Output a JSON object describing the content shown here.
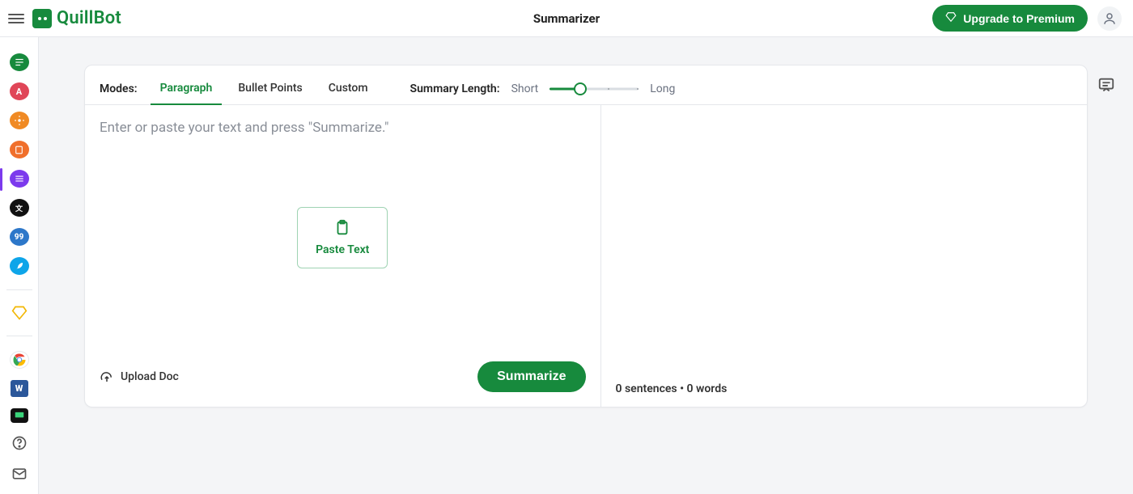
{
  "header": {
    "brand": "QuillBot",
    "title": "Summarizer",
    "upgrade_label": "Upgrade to Premium"
  },
  "sidebar": {
    "items": [
      {
        "name": "paraphraser",
        "bg": "#178a3d",
        "glyph": "≡"
      },
      {
        "name": "grammar",
        "bg": "#e04658",
        "glyph": "A✓"
      },
      {
        "name": "plagiarism",
        "bg": "#f08a24",
        "glyph": "✦"
      },
      {
        "name": "cowriter",
        "bg": "#f06f2b",
        "glyph": "▣"
      },
      {
        "name": "summarizer",
        "bg": "#7c3aed",
        "glyph": "≣",
        "active": true
      },
      {
        "name": "translator",
        "bg": "#111111",
        "glyph": "文A"
      },
      {
        "name": "citation",
        "bg": "#2d77c9",
        "glyph": "99"
      },
      {
        "name": "flow",
        "bg": "#0ea5e9",
        "glyph": "✎"
      }
    ],
    "premium_name": "premium",
    "apps": [
      {
        "name": "chrome-extension",
        "bg": "#ffffff"
      },
      {
        "name": "word-addin",
        "bg": "#2b579a"
      },
      {
        "name": "mac-app",
        "bg": "#111111"
      }
    ],
    "bottom": [
      {
        "name": "help",
        "glyph": "?"
      },
      {
        "name": "contact",
        "glyph": "✉"
      }
    ]
  },
  "modes": {
    "label": "Modes:",
    "tabs": [
      {
        "label": "Paragraph",
        "active": true
      },
      {
        "label": "Bullet Points",
        "active": false
      },
      {
        "label": "Custom",
        "active": false
      }
    ]
  },
  "length": {
    "label": "Summary Length:",
    "short": "Short",
    "long": "Long"
  },
  "input": {
    "placeholder": "Enter or paste your text and press \"Summarize.\"",
    "paste_label": "Paste Text",
    "upload_label": "Upload Doc",
    "summarize_label": "Summarize"
  },
  "output": {
    "sentences_count": 0,
    "sentences_suffix": " sentences",
    "sep": "  •  ",
    "words_count": 0,
    "words_suffix": " words"
  }
}
